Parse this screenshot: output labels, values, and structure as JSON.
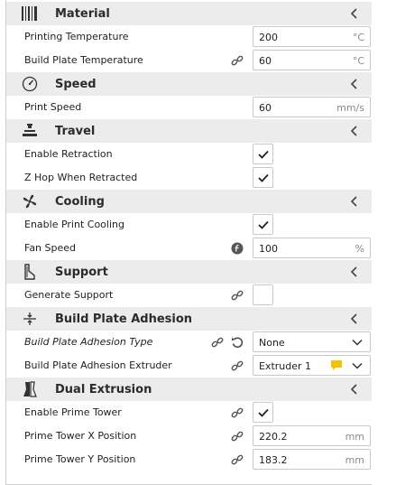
{
  "categories": {
    "material": {
      "title": "Material",
      "settings": {
        "printing_temperature": {
          "label": "Printing Temperature",
          "value": "200",
          "unit": "°C"
        },
        "build_plate_temperature": {
          "label": "Build Plate Temperature",
          "value": "60",
          "unit": "°C"
        }
      }
    },
    "speed": {
      "title": "Speed",
      "settings": {
        "print_speed": {
          "label": "Print Speed",
          "value": "60",
          "unit": "mm/s"
        }
      }
    },
    "travel": {
      "title": "Travel",
      "settings": {
        "enable_retraction": {
          "label": "Enable Retraction",
          "checked": true
        },
        "z_hop": {
          "label": "Z Hop When Retracted",
          "checked": true
        }
      }
    },
    "cooling": {
      "title": "Cooling",
      "settings": {
        "enable_print_cooling": {
          "label": "Enable Print Cooling",
          "checked": true
        },
        "fan_speed": {
          "label": "Fan Speed",
          "value": "100",
          "unit": "%"
        }
      }
    },
    "support": {
      "title": "Support",
      "settings": {
        "generate_support": {
          "label": "Generate Support",
          "checked": false
        }
      }
    },
    "adhesion": {
      "title": "Build Plate Adhesion",
      "settings": {
        "adhesion_type": {
          "label": "Build Plate Adhesion Type",
          "value": "None"
        },
        "adhesion_extruder": {
          "label": "Build Plate Adhesion Extruder",
          "value": "Extruder 1"
        }
      }
    },
    "dual": {
      "title": "Dual Extrusion",
      "settings": {
        "enable_prime_tower": {
          "label": "Enable Prime Tower",
          "checked": true
        },
        "prime_tower_x": {
          "label": "Prime Tower X Position",
          "value": "220.2",
          "unit": "mm"
        },
        "prime_tower_y": {
          "label": "Prime Tower Y Position",
          "value": "183.2",
          "unit": "mm"
        }
      }
    }
  },
  "icons": {
    "material": "material-icon",
    "speed": "speed-gauge-icon",
    "travel": "travel-icon",
    "cooling": "fan-icon",
    "support": "support-icon",
    "adhesion": "adhesion-icon",
    "dual": "dual-extrusion-icon",
    "link": "link-icon",
    "reset": "reset-icon",
    "f": "f-icon",
    "warning": "warning-icon",
    "chevron": "chevron-left-icon"
  },
  "colors": {
    "category_bg": "#ececec",
    "warning": "#f3c200",
    "text": "#1f1f1f"
  }
}
